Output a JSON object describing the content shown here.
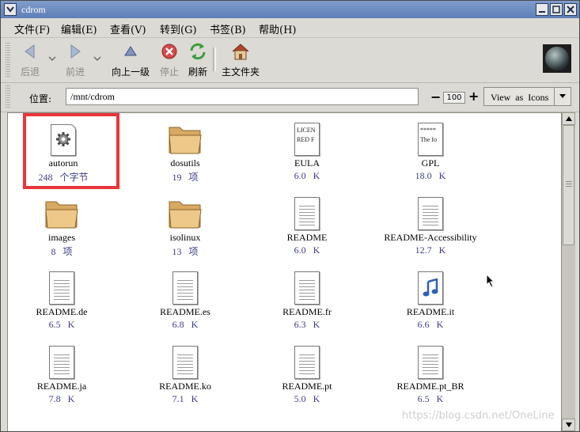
{
  "window": {
    "title": "cdrom"
  },
  "menubar": {
    "items": [
      {
        "label": "文件(F)"
      },
      {
        "label": "编辑(E)"
      },
      {
        "label": "查看(V)"
      },
      {
        "label": "转到(G)"
      },
      {
        "label": "书签(B)"
      },
      {
        "label": "帮助(H)"
      }
    ]
  },
  "toolbar": {
    "back": "后退",
    "forward": "前进",
    "up": "向上一级",
    "stop": "停止",
    "refresh": "刷新",
    "home": "主文件夹"
  },
  "location": {
    "label": "位置:",
    "value": "/mnt/cdrom",
    "zoom": "100",
    "view_as": "View as Icons"
  },
  "files": [
    {
      "name": "autorun",
      "info": "248 个字节",
      "icon": "executable-gear-icon"
    },
    {
      "name": "dosutils",
      "info": "19 项",
      "icon": "folder-icon"
    },
    {
      "name": "EULA",
      "info": "6.0 K",
      "icon": "text-document-icon",
      "preview1": "LICEN",
      "preview2": "RED F"
    },
    {
      "name": "GPL",
      "info": "18.0 K",
      "icon": "text-document-icon",
      "preview1": "*****",
      "preview2": "The fo"
    },
    {
      "name": "images",
      "info": "8 项",
      "icon": "folder-icon"
    },
    {
      "name": "isolinux",
      "info": "13 项",
      "icon": "folder-icon"
    },
    {
      "name": "README",
      "info": "6.0 K",
      "icon": "text-document-icon"
    },
    {
      "name": "README-Accessibility",
      "info": "12.7 K",
      "icon": "text-document-icon"
    },
    {
      "name": "README.de",
      "info": "6.5 K",
      "icon": "text-document-icon"
    },
    {
      "name": "README.es",
      "info": "6.8 K",
      "icon": "text-document-icon"
    },
    {
      "name": "README.fr",
      "info": "6.3 K",
      "icon": "text-document-icon"
    },
    {
      "name": "README.it",
      "info": "6.6 K",
      "icon": "audio-file-icon"
    },
    {
      "name": "README.ja",
      "info": "7.8 K",
      "icon": "text-document-icon"
    },
    {
      "name": "README.ko",
      "info": "7.1 K",
      "icon": "text-document-icon"
    },
    {
      "name": "README.pt",
      "info": "5.0 K",
      "icon": "text-document-icon"
    },
    {
      "name": "README.pt_BR",
      "info": "6.5 K",
      "icon": "text-document-icon"
    }
  ],
  "watermark": "https://blog.csdn.net/OneLine",
  "colors": {
    "titlebar": "#5e7fb8",
    "highlight": "#e8353b",
    "info_text": "#3b3b8a"
  }
}
